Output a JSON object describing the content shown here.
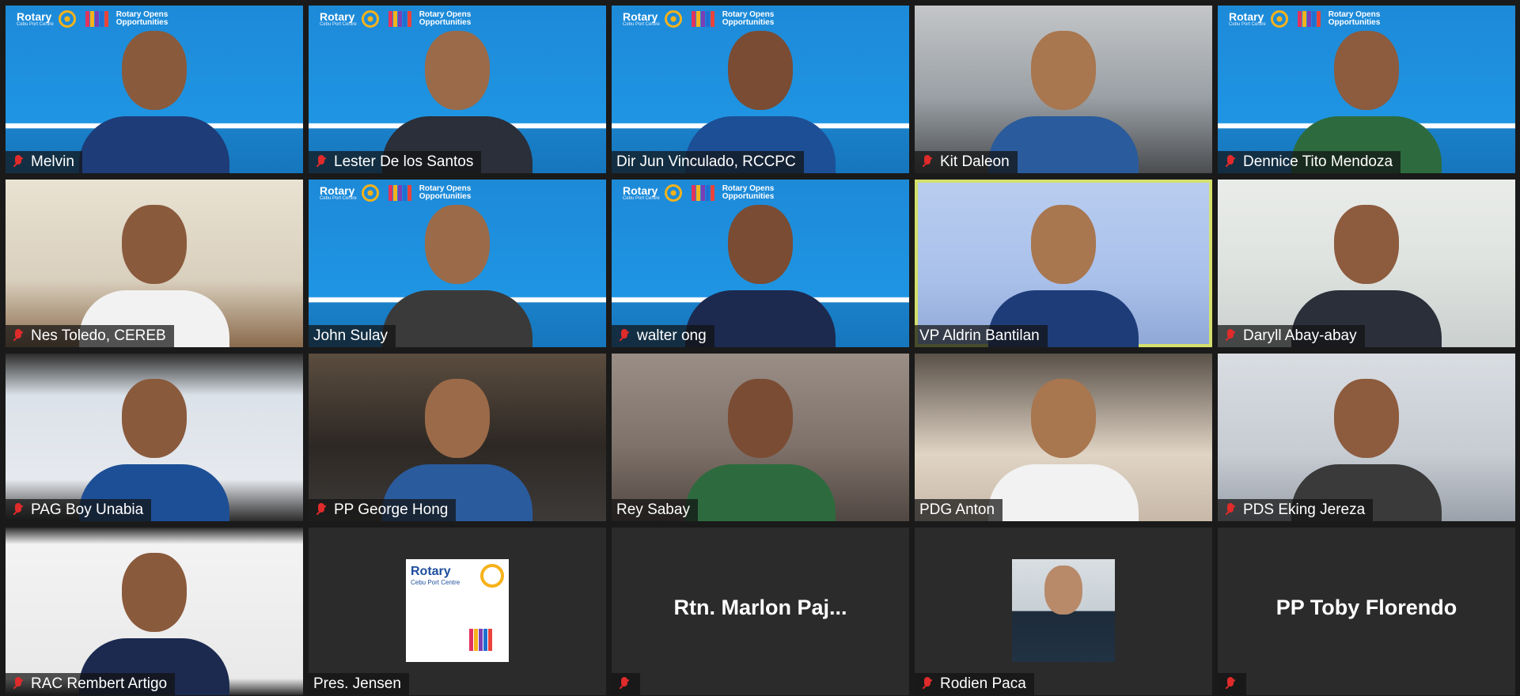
{
  "banner": {
    "rotary": "Rotary",
    "club": "Cebu Port Centre",
    "opens": "Rotary Opens Opportunities"
  },
  "colors": {
    "active_speaker_border": "#d4e06c",
    "muted_icon": "#e02b2b",
    "name_label_bg": "rgba(18,18,18,0.72)",
    "rotary_bar_colors": [
      "#e3325d",
      "#f7b21b",
      "#7b3fb5",
      "#1f6fd1",
      "#e9433a"
    ]
  },
  "participants": [
    {
      "name": "Melvin",
      "muted": true,
      "bg": "rotary",
      "active": false
    },
    {
      "name": "Lester De los Santos",
      "muted": true,
      "bg": "rotary",
      "active": false
    },
    {
      "name": "Dir Jun Vinculado, RCCPC",
      "muted": false,
      "bg": "rotary",
      "active": false
    },
    {
      "name": "Kit Daleon",
      "muted": true,
      "bg": "room4",
      "active": false
    },
    {
      "name": "Dennice Tito Mendoza",
      "muted": true,
      "bg": "rotary",
      "active": false
    },
    {
      "name": "Nes Toledo, CEREB",
      "muted": true,
      "bg": "room1",
      "active": false
    },
    {
      "name": "John Sulay",
      "muted": false,
      "bg": "rotary",
      "active": false
    },
    {
      "name": "walter ong",
      "muted": true,
      "bg": "rotary",
      "active": false
    },
    {
      "name": "VP Aldrin Bantilan",
      "muted": false,
      "bg": "lightblue",
      "active": true
    },
    {
      "name": "Daryll Abay-abay",
      "muted": true,
      "bg": "office",
      "active": false
    },
    {
      "name": "PAG Boy Unabia",
      "muted": true,
      "bg": "room7",
      "active": false
    },
    {
      "name": "PP George Hong",
      "muted": true,
      "bg": "room3",
      "active": false
    },
    {
      "name": "Rey Sabay",
      "muted": false,
      "bg": "room5",
      "active": false
    },
    {
      "name": "PDG Anton",
      "muted": false,
      "bg": "room6",
      "active": false
    },
    {
      "name": "PDS Eking Jereza",
      "muted": true,
      "bg": "room2",
      "active": false
    },
    {
      "name": "RAC Rembert Artigo",
      "muted": true,
      "bg": "room8",
      "active": false
    },
    {
      "name": "Pres. Jensen",
      "muted": false,
      "bg": "dark",
      "active": false,
      "avatar": "rotary"
    },
    {
      "name": "",
      "muted": true,
      "bg": "dark",
      "active": false,
      "display_name": "Rtn.  Marlon  Paj..."
    },
    {
      "name": "Rodien Paca",
      "muted": true,
      "bg": "dark",
      "active": false,
      "avatar": "photo"
    },
    {
      "name": "",
      "muted": true,
      "bg": "dark",
      "active": false,
      "display_name": "PP Toby Florendo"
    }
  ]
}
